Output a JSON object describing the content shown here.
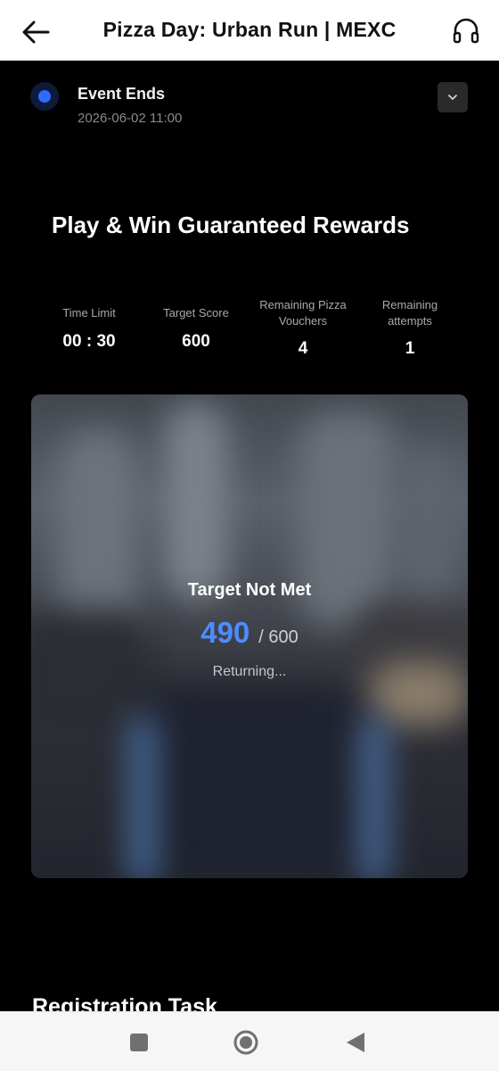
{
  "appbar": {
    "title": "Pizza Day: Urban Run | MEXC",
    "back_icon": "arrow-left-icon",
    "support_icon": "headset-icon"
  },
  "event": {
    "label": "Event Ends",
    "date": "2026-06-02 11:00",
    "indicator_color": "#2f6bff"
  },
  "headline": "Play & Win Guaranteed Rewards",
  "stats": [
    {
      "label": "Time Limit",
      "value": "00 : 30"
    },
    {
      "label": "Target Score",
      "value": "600"
    },
    {
      "label_line1": "Remaining Pizza",
      "label_line2": "Vouchers",
      "value": "4"
    },
    {
      "label_line1": "Remaining",
      "label_line2": "attempts",
      "value": "1"
    }
  ],
  "game": {
    "result_title": "Target Not Met",
    "score": "490",
    "target": "/ 600",
    "status": "Returning...",
    "accent": "#4d8cff"
  },
  "section_title": "Registration Task",
  "navbar": {
    "recents_icon": "square-icon",
    "home_icon": "circle-home-icon",
    "back_icon": "triangle-back-icon"
  }
}
